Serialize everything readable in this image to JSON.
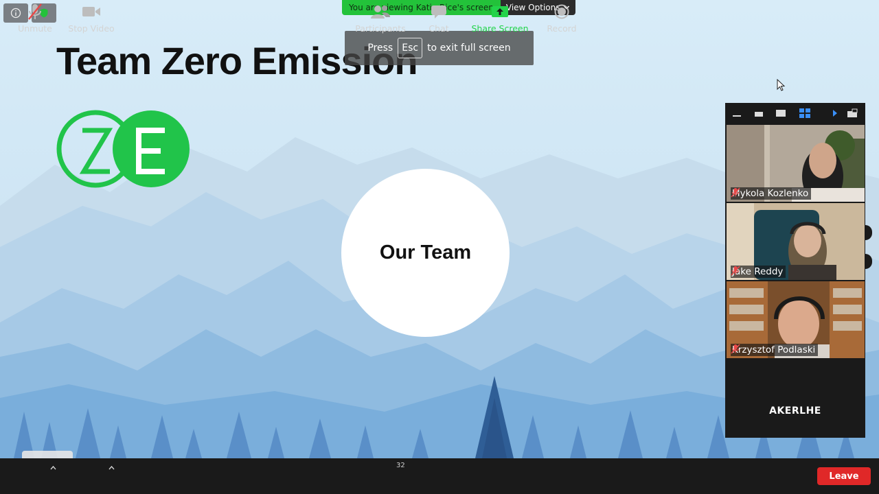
{
  "slide": {
    "title": "Team Zero Emission",
    "logo_letters": "ZE",
    "circle_text": "Our Team",
    "brand_green": "#21c44a"
  },
  "top_bar": {
    "viewing_text": "You are viewing Katie Rice's screen",
    "view_options_label": "View Options",
    "info_icon": "info-icon",
    "security_icon": "shield-icon"
  },
  "toast": {
    "press": "Press",
    "key": "Esc",
    "suffix": "to exit full screen"
  },
  "participants_panel": {
    "tiles": [
      {
        "name": "Mykola Kozlenko",
        "muted": true
      },
      {
        "name": "Jake Reddy",
        "muted": true
      },
      {
        "name": "Krzysztof Podlaski",
        "muted": true
      }
    ],
    "extra_participant": "AKERLHE"
  },
  "toolbar": {
    "unmute_label": "Unmute",
    "stop_video_label": "Stop Video",
    "participants_label": "Participants",
    "participants_count": "32",
    "chat_label": "Chat",
    "share_screen_label": "Share Screen",
    "record_label": "Record",
    "leave_label": "Leave",
    "accent_green": "#23d34a",
    "leave_red": "#e02828"
  }
}
